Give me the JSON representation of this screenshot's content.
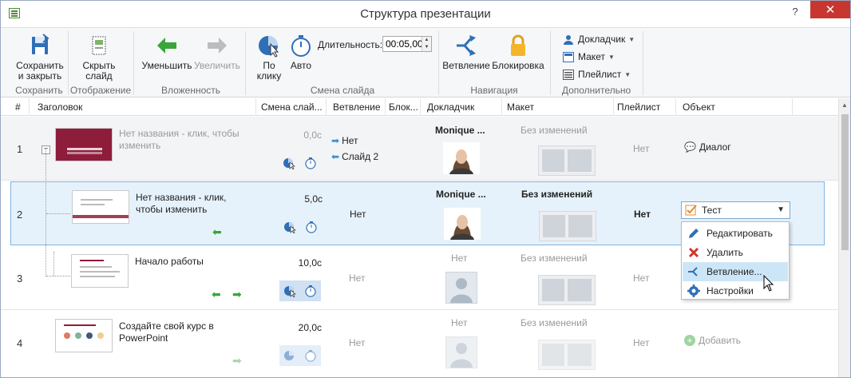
{
  "window": {
    "title": "Структура презентации",
    "help": "?",
    "close": "✕"
  },
  "ribbon": {
    "save": {
      "line1": "Сохранить",
      "line2": "и закрыть",
      "group": "Сохранить"
    },
    "hide": {
      "line1": "Скрыть",
      "line2": "слайд",
      "group": "Отображение"
    },
    "decrease": "Уменьшить",
    "increase": "Увеличить",
    "nesting_group": "Вложенность",
    "on_click": {
      "line1": "По",
      "line2": "клику"
    },
    "auto": "Авто",
    "duration_label": "Длительность:",
    "duration_value": "00:05,00",
    "slide_change_group": "Смена слайда",
    "branching": "Ветвление",
    "lock": "Блокировка",
    "navigation_group": "Навигация",
    "presenter": "Докладчик",
    "layout": "Макет",
    "playlist": "Плейлист",
    "extra_group": "Дополнительно"
  },
  "grid": {
    "headers": [
      "#",
      "Заголовок",
      "Смена слай...",
      "Ветвление",
      "Блок...",
      "Докладчик",
      "Макет",
      "Плейлист",
      "Объект"
    ],
    "rows": [
      {
        "num": "1",
        "title": "Нет названия - клик, чтобы изменить",
        "duration": "0,0с",
        "branch_next": "Нет",
        "branch_prev": "Слайд 2",
        "presenter": "Monique ...",
        "layout": "Без изменений",
        "playlist": "Нет",
        "object": "Диалог"
      },
      {
        "num": "2",
        "title": "Нет названия - клик, чтобы изменить",
        "duration": "5,0с",
        "branch": "Нет",
        "presenter": "Monique ...",
        "layout": "Без изменений",
        "playlist": "Нет",
        "object": "Тест"
      },
      {
        "num": "3",
        "title": "Начало работы",
        "duration": "10,0с",
        "branch": "Нет",
        "presenter": "Нет",
        "layout": "Без изменений",
        "playlist": "Нет"
      },
      {
        "num": "4",
        "title": "Создайте свой курс в PowerPoint",
        "duration": "20,0с",
        "branch": "Нет",
        "presenter": "Нет",
        "layout": "Без изменений",
        "playlist": "Нет",
        "object": "Добавить"
      }
    ]
  },
  "menu": {
    "items": [
      "Редактировать",
      "Удалить",
      "Ветвление...",
      "Настройки"
    ]
  },
  "colors": {
    "accent": "#3c8fd6",
    "green": "#3aa53a",
    "selection": "#e6f2fb",
    "brand_red": "#8e1d3b"
  }
}
